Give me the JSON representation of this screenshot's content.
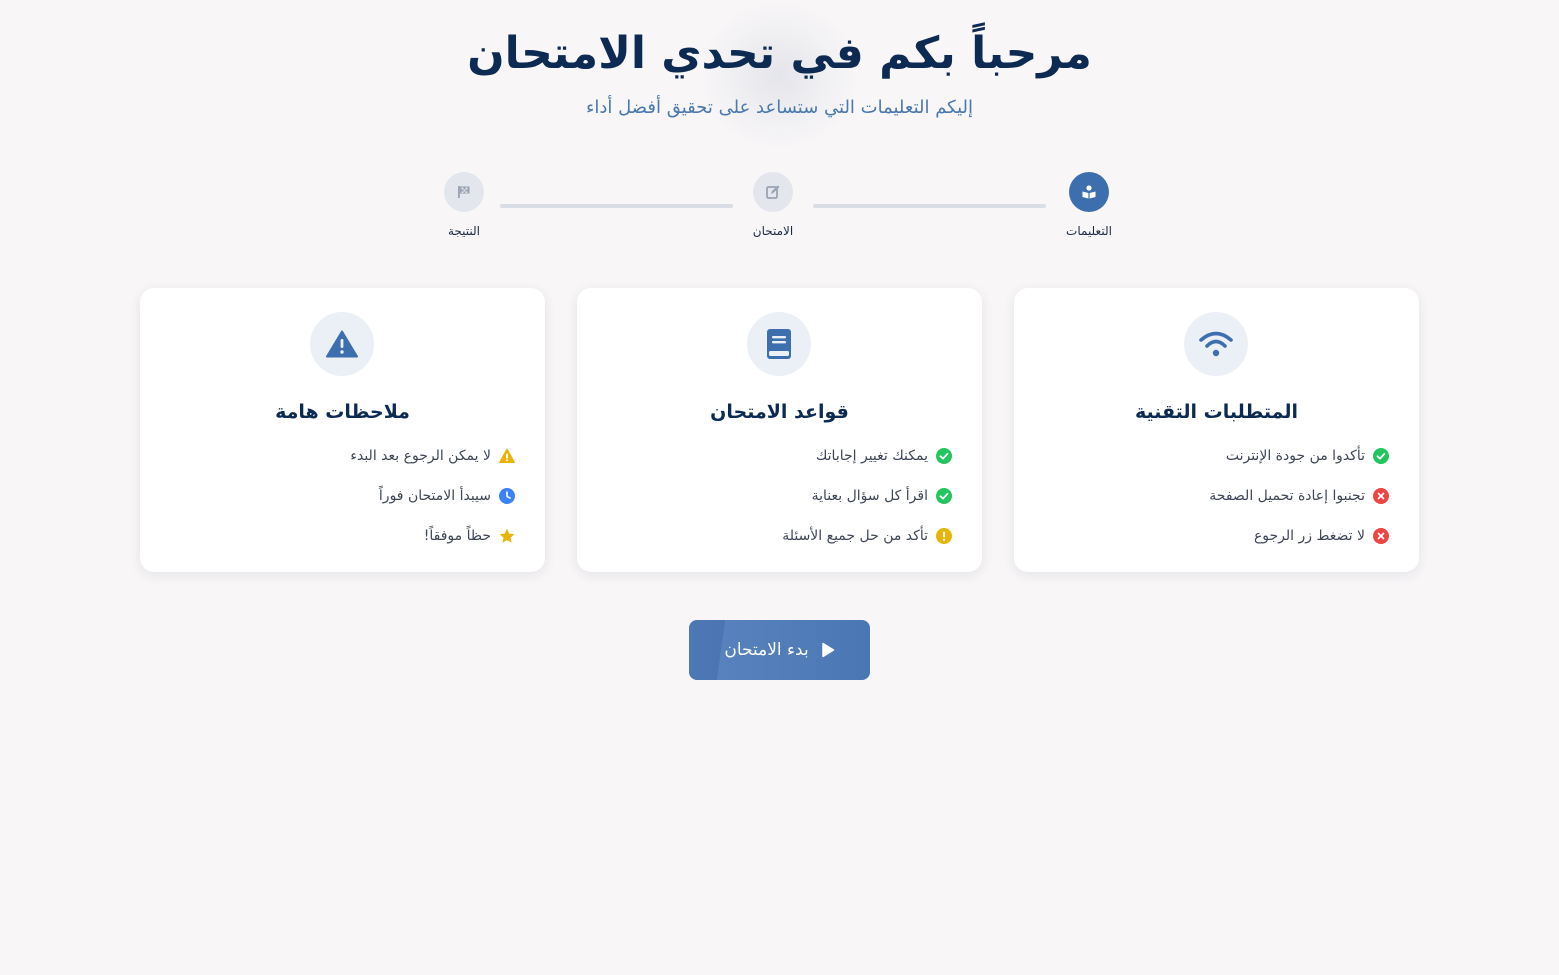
{
  "header": {
    "title": "مرحباً بكم في تحدي الامتحان",
    "subtitle": "إليكم التعليمات التي ستساعد على تحقيق أفضل أداء"
  },
  "steps": [
    {
      "label": "التعليمات",
      "icon": "reader-icon",
      "active": true
    },
    {
      "label": "الامتحان",
      "icon": "edit-icon",
      "active": false
    },
    {
      "label": "النتيجة",
      "icon": "flag-icon",
      "active": false
    }
  ],
  "cards": [
    {
      "title": "المتطلبات التقنية",
      "icon": "wifi-icon",
      "items": [
        {
          "text": "تأكدوا من جودة الإنترنت",
          "icon": "check-circle-icon"
        },
        {
          "text": "تجنبوا إعادة تحميل الصفحة",
          "icon": "x-circle-icon"
        },
        {
          "text": "لا تضغط زر الرجوع",
          "icon": "x-circle-icon"
        }
      ]
    },
    {
      "title": "قواعد الامتحان",
      "icon": "book-icon",
      "items": [
        {
          "text": "يمكنك تغيير إجاباتك",
          "icon": "check-circle-icon"
        },
        {
          "text": "اقرأ كل سؤال بعناية",
          "icon": "check-circle-icon"
        },
        {
          "text": "تأكد من حل جميع الأسئلة",
          "icon": "exclamation-circle-icon"
        }
      ]
    },
    {
      "title": "ملاحظات هامة",
      "icon": "warning-icon",
      "items": [
        {
          "text": "لا يمكن الرجوع بعد البدء",
          "icon": "warning-icon"
        },
        {
          "text": "سيبدأ الامتحان فوراً",
          "icon": "clock-icon"
        },
        {
          "text": "حظاً موفقاً!",
          "icon": "star-icon"
        }
      ]
    }
  ],
  "start_button": {
    "label": "بدء الامتحان",
    "icon": "play-icon"
  },
  "colors": {
    "primary": "#3d6fae",
    "heading": "#0d2a52",
    "success": "#22c55e",
    "danger": "#ef4444",
    "warning": "#eab308",
    "info": "#3b82f6"
  }
}
